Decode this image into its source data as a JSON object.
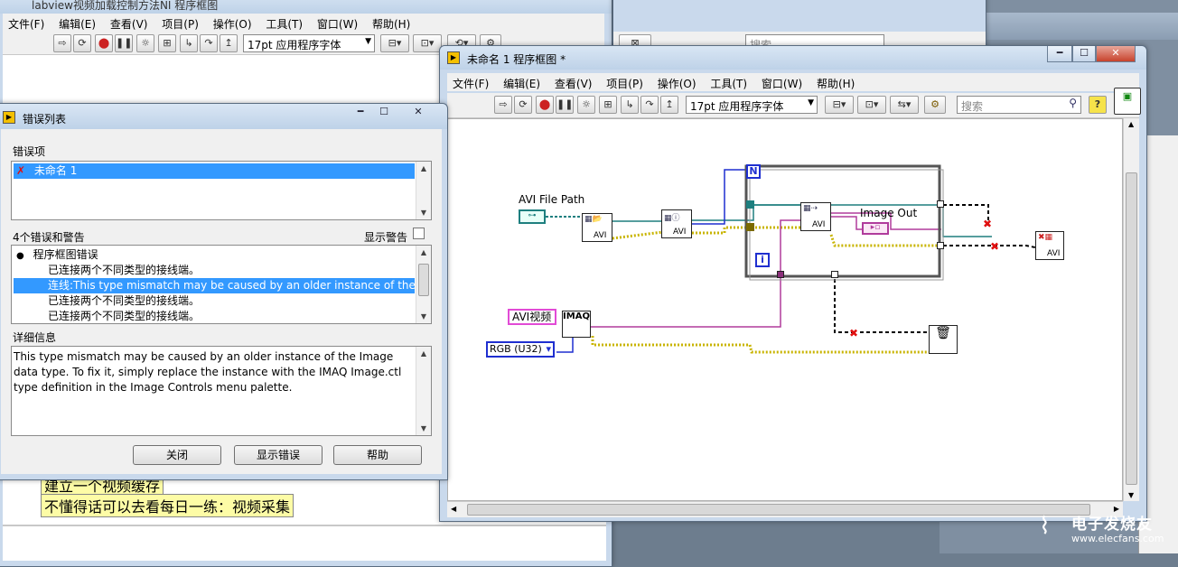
{
  "background_window": {
    "title": "labview视频加载控制方法NI 程序框图",
    "menu": [
      "文件(F)",
      "编辑(E)",
      "查看(V)",
      "项目(P)",
      "操作(O)",
      "工具(T)",
      "窗口(W)",
      "帮助(H)"
    ],
    "font_combo": "17pt 应用程序字体",
    "search_placeholder": "搜索",
    "sticky_notes": [
      "建立一个视频缓存",
      "不懂得话可以去看每日一练：视频采集"
    ]
  },
  "error_dialog": {
    "title": "错误列表",
    "items_label": "错误项",
    "items": [
      {
        "label": "未命名 1",
        "mark": "✗"
      }
    ],
    "count_label": "4个错误和警告",
    "show_warnings_label": "显示警告",
    "show_warnings_checked": false,
    "errors": [
      {
        "text": "程序框图错误",
        "bullet": "●",
        "selected": false
      },
      {
        "text": "已连接两个不同类型的接线端。",
        "selected": false
      },
      {
        "text": "连线:This type mismatch may be caused by an older instance of the Im",
        "selected": true
      },
      {
        "text": "已连接两个不同类型的接线端。",
        "selected": false
      },
      {
        "text": "已连接两个不同类型的接线端。",
        "selected": false
      }
    ],
    "details_label": "详细信息",
    "details_text": "This type mismatch may be caused by an older instance of the Image data type.  To fix it, simply replace the instance with the IMAQ Image.ctl type definition in the Image Controls menu palette.",
    "buttons": {
      "close": "关闭",
      "show_error": "显示错误",
      "help": "帮助"
    }
  },
  "main_window": {
    "title": "未命名 1 程序框图 *",
    "menu": [
      "文件(F)",
      "编辑(E)",
      "查看(V)",
      "项目(P)",
      "操作(O)",
      "工具(T)",
      "窗口(W)",
      "帮助(H)"
    ],
    "font_combo": "17pt 应用程序字体",
    "search_placeholder": "搜索",
    "diagram": {
      "avi_path_label": "AVI File Path",
      "image_out_label": "Image Out",
      "avi_video_const": "AVI视频",
      "rgb_combo": "RGB (U32)",
      "imaq_label": "IMAQ",
      "loop_n": "N",
      "loop_i": "i",
      "avi_tag": "AVI"
    }
  },
  "watermark": {
    "brand": "电子发烧友",
    "url": "www.elecfans.com"
  },
  "colors": {
    "selection": "#3399ff",
    "wire_pink": "#b03b9c",
    "wire_teal": "#1e7f7f",
    "wire_blue": "#1f2fd0",
    "wire_yellow": "#c8b400",
    "error_red": "#e01010"
  }
}
